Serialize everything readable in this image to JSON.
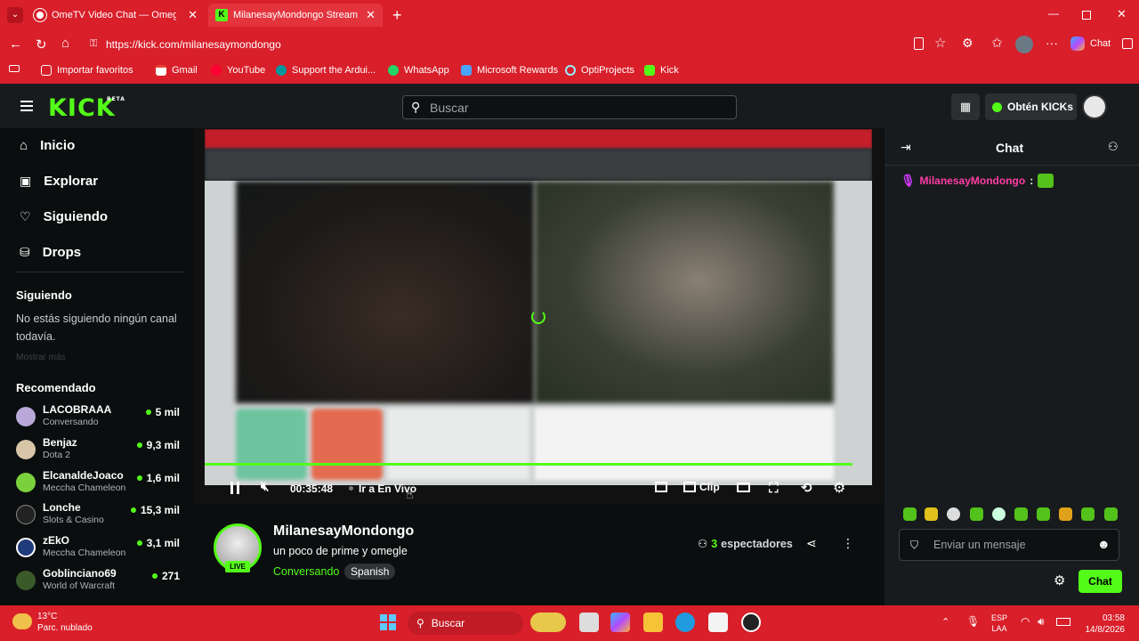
{
  "browser": {
    "tabs": [
      {
        "label": "OmeTV Video Chat — Omegl"
      },
      {
        "label": "MilanesayMondongo Stream - Wa"
      }
    ],
    "url": "https://kick.com/milanesaymondongo",
    "copilot_label": "Chat",
    "bookmarks": [
      "Importar favoritos",
      "Gmail",
      "YouTube",
      "Support the Ardui...",
      "WhatsApp",
      "Microsoft Rewards",
      "OptiProjects",
      "Kick"
    ]
  },
  "header": {
    "logo": "KICK",
    "logo_badge": "BETA",
    "search_placeholder": "Buscar",
    "get_kicks_label": "Obtén KICKs"
  },
  "sidebar": {
    "nav": [
      "Inicio",
      "Explorar",
      "Siguiendo",
      "Drops"
    ],
    "following_title": "Siguiendo",
    "following_empty": "No estás siguiendo ningún canal todavía.",
    "show_more": "Mostrar más",
    "recommended_title": "Recomendado",
    "recommended": [
      {
        "name": "LACOBRAAA",
        "category": "Conversando",
        "viewers": "5 mil"
      },
      {
        "name": "Benjaz",
        "category": "Dota 2",
        "viewers": "9,3 mil"
      },
      {
        "name": "ElcanaldeJoaco",
        "category": "Meccha Chameleon",
        "viewers": "1,6 mil"
      },
      {
        "name": "Lonche",
        "category": "Slots & Casino",
        "viewers": "15,3 mil"
      },
      {
        "name": "zEkO",
        "category": "Meccha Chameleon",
        "viewers": "3,1 mil"
      },
      {
        "name": "Goblinciano69",
        "category": "World of Warcraft",
        "viewers": "271"
      }
    ]
  },
  "player": {
    "time": "00:35:48",
    "go_live": "Ir a En Vivo",
    "clip_label": "Clip",
    "progress": 0.97
  },
  "stream": {
    "channel": "MilanesayMondongo",
    "title": "un poco de prime y omegle",
    "category": "Conversando",
    "language": "Spanish",
    "live_badge": "LIVE",
    "viewers_count": "3",
    "viewers_label": "espectadores"
  },
  "chat": {
    "title": "Chat",
    "message_user": "MilanesayMondongo",
    "input_placeholder": "Enviar un mensaje",
    "send_label": "Chat"
  },
  "taskbar": {
    "weather_temp": "13°C",
    "weather_desc": "Parc. nublado",
    "search_placeholder": "Buscar",
    "lang": "ESP",
    "lang2": "LAA",
    "time": "03:58",
    "date": "14/8/2026"
  },
  "colors": {
    "accent": "#53fc18",
    "browser": "#d81f2a",
    "bg": "#0b0e0f",
    "panel": "#181b1d"
  }
}
